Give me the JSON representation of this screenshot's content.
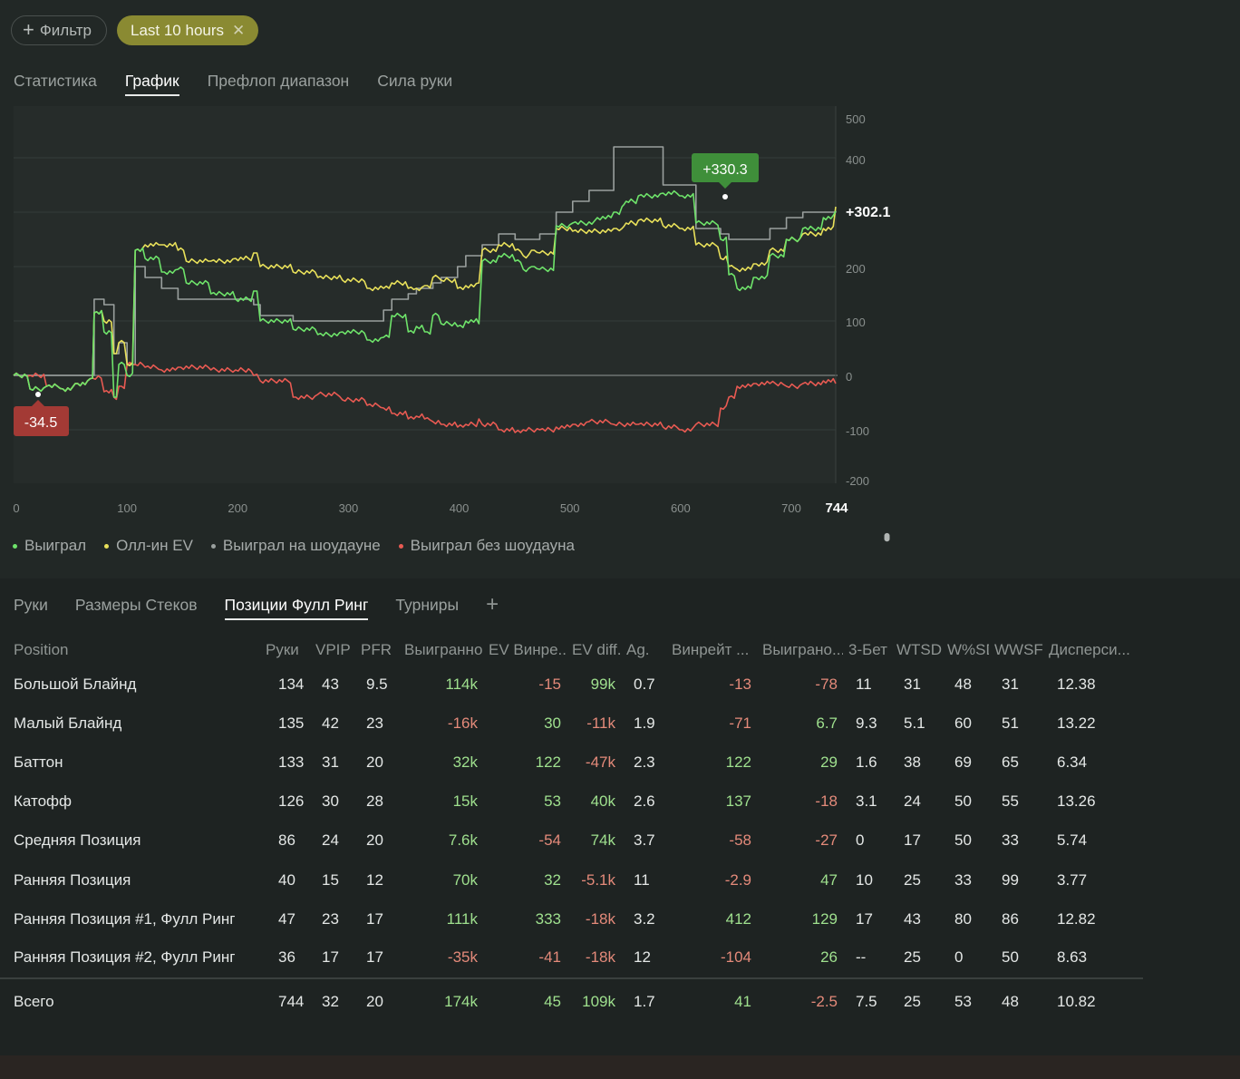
{
  "filters": {
    "add_label": "Фильтр",
    "time_chip": "Last 10 hours"
  },
  "top_tabs": [
    {
      "label": "Статистика",
      "active": false
    },
    {
      "label": "График",
      "active": true
    },
    {
      "label": "Префлоп диапазон",
      "active": false
    },
    {
      "label": "Сила руки",
      "active": false
    }
  ],
  "chart_data": {
    "type": "line",
    "xlim": [
      0,
      744
    ],
    "ylim": [
      -200,
      500
    ],
    "x_ticks": [
      0,
      100,
      200,
      300,
      400,
      500,
      600,
      700
    ],
    "x_end_label": "744",
    "y_ticks": [
      500,
      400,
      200,
      100,
      0,
      -100,
      -200
    ],
    "annotations": [
      {
        "label": "+330.3",
        "x": 642,
        "y": 330.3,
        "color": "#3f8f3a"
      },
      {
        "label": "-34.5",
        "x": 22,
        "y": -34.5,
        "color": "#a33a35"
      },
      {
        "label": "+302.1",
        "x": 744,
        "y": 302.1
      }
    ],
    "series": [
      {
        "name": "Выиграл",
        "color": "#6ee36a",
        "points": [
          [
            0,
            0
          ],
          [
            20,
            -25
          ],
          [
            40,
            -20
          ],
          [
            60,
            -25
          ],
          [
            75,
            -15
          ],
          [
            90,
            -10
          ],
          [
            96,
            -5
          ],
          [
            98,
            115
          ],
          [
            110,
            80
          ],
          [
            122,
            -40
          ],
          [
            128,
            20
          ],
          [
            138,
            0
          ],
          [
            148,
            230
          ],
          [
            160,
            215
          ],
          [
            180,
            190
          ],
          [
            200,
            195
          ],
          [
            210,
            170
          ],
          [
            240,
            150
          ],
          [
            270,
            140
          ],
          [
            292,
            155
          ],
          [
            300,
            100
          ],
          [
            340,
            85
          ],
          [
            370,
            75
          ],
          [
            400,
            80
          ],
          [
            430,
            65
          ],
          [
            450,
            70
          ],
          [
            460,
            110
          ],
          [
            480,
            80
          ],
          [
            490,
            90
          ],
          [
            500,
            80
          ],
          [
            510,
            110
          ],
          [
            520,
            95
          ],
          [
            540,
            90
          ],
          [
            550,
            100
          ],
          [
            566,
            95
          ],
          [
            570,
            210
          ],
          [
            590,
            220
          ],
          [
            610,
            210
          ],
          [
            620,
            195
          ],
          [
            630,
            200
          ],
          [
            640,
            195
          ],
          [
            660,
            275
          ],
          [
            680,
            280
          ],
          [
            710,
            290
          ],
          [
            730,
            300
          ],
          [
            740,
            310
          ],
          [
            745,
            320
          ],
          [
            760,
            330
          ],
          [
            790,
            335
          ],
          [
            810,
            330
          ],
          [
            830,
            280
          ],
          [
            860,
            250
          ],
          [
            870,
            185
          ],
          [
            880,
            160
          ],
          [
            900,
            180
          ],
          [
            920,
            220
          ],
          [
            940,
            250
          ],
          [
            960,
            270
          ],
          [
            985,
            290
          ],
          [
            1000,
            302
          ]
        ]
      },
      {
        "name": "Олл-ин EV",
        "color": "#e8e05a",
        "points": [
          [
            0,
            0
          ],
          [
            20,
            -25
          ],
          [
            40,
            -20
          ],
          [
            60,
            -25
          ],
          [
            75,
            -15
          ],
          [
            90,
            -10
          ],
          [
            96,
            -5
          ],
          [
            98,
            115
          ],
          [
            110,
            100
          ],
          [
            122,
            40
          ],
          [
            128,
            60
          ],
          [
            138,
            20
          ],
          [
            148,
            230
          ],
          [
            160,
            240
          ],
          [
            180,
            240
          ],
          [
            200,
            230
          ],
          [
            210,
            210
          ],
          [
            240,
            210
          ],
          [
            270,
            215
          ],
          [
            292,
            225
          ],
          [
            300,
            200
          ],
          [
            340,
            190
          ],
          [
            370,
            180
          ],
          [
            400,
            175
          ],
          [
            430,
            160
          ],
          [
            450,
            160
          ],
          [
            460,
            170
          ],
          [
            480,
            160
          ],
          [
            490,
            160
          ],
          [
            500,
            165
          ],
          [
            510,
            180
          ],
          [
            520,
            175
          ],
          [
            540,
            160
          ],
          [
            550,
            165
          ],
          [
            566,
            170
          ],
          [
            570,
            230
          ],
          [
            590,
            240
          ],
          [
            610,
            230
          ],
          [
            620,
            220
          ],
          [
            630,
            230
          ],
          [
            640,
            225
          ],
          [
            660,
            270
          ],
          [
            680,
            265
          ],
          [
            710,
            265
          ],
          [
            730,
            270
          ],
          [
            740,
            270
          ],
          [
            745,
            280
          ],
          [
            760,
            285
          ],
          [
            790,
            275
          ],
          [
            810,
            270
          ],
          [
            830,
            240
          ],
          [
            860,
            215
          ],
          [
            870,
            200
          ],
          [
            880,
            195
          ],
          [
            900,
            205
          ],
          [
            920,
            230
          ],
          [
            940,
            250
          ],
          [
            960,
            260
          ],
          [
            985,
            270
          ],
          [
            1000,
            310
          ]
        ]
      },
      {
        "name": "Выиграл на шоудауне",
        "color": "#9aa09e",
        "points": [
          [
            0,
            0
          ],
          [
            60,
            0
          ],
          [
            96,
            0
          ],
          [
            98,
            140
          ],
          [
            110,
            130
          ],
          [
            122,
            40
          ],
          [
            128,
            60
          ],
          [
            138,
            20
          ],
          [
            148,
            200
          ],
          [
            160,
            180
          ],
          [
            180,
            160
          ],
          [
            200,
            140
          ],
          [
            240,
            140
          ],
          [
            270,
            140
          ],
          [
            292,
            130
          ],
          [
            300,
            110
          ],
          [
            340,
            100
          ],
          [
            370,
            100
          ],
          [
            400,
            100
          ],
          [
            430,
            100
          ],
          [
            450,
            120
          ],
          [
            460,
            140
          ],
          [
            480,
            150
          ],
          [
            490,
            160
          ],
          [
            500,
            160
          ],
          [
            510,
            170
          ],
          [
            520,
            180
          ],
          [
            540,
            200
          ],
          [
            550,
            220
          ],
          [
            566,
            220
          ],
          [
            570,
            240
          ],
          [
            590,
            260
          ],
          [
            610,
            250
          ],
          [
            620,
            250
          ],
          [
            640,
            260
          ],
          [
            660,
            300
          ],
          [
            680,
            320
          ],
          [
            700,
            340
          ],
          [
            730,
            420
          ],
          [
            760,
            420
          ],
          [
            790,
            350
          ],
          [
            810,
            350
          ],
          [
            830,
            270
          ],
          [
            860,
            260
          ],
          [
            870,
            250
          ],
          [
            880,
            250
          ],
          [
            900,
            250
          ],
          [
            920,
            270
          ],
          [
            940,
            290
          ],
          [
            960,
            300
          ],
          [
            985,
            300
          ],
          [
            1000,
            302
          ]
        ]
      },
      {
        "name": "Выиграл без шоудауна",
        "color": "#e85a52",
        "points": [
          [
            0,
            0
          ],
          [
            20,
            0
          ],
          [
            40,
            -20
          ],
          [
            60,
            -25
          ],
          [
            75,
            -15
          ],
          [
            90,
            -10
          ],
          [
            96,
            -5
          ],
          [
            110,
            -30
          ],
          [
            122,
            -40
          ],
          [
            128,
            -20
          ],
          [
            138,
            20
          ],
          [
            148,
            20
          ],
          [
            160,
            15
          ],
          [
            180,
            10
          ],
          [
            200,
            15
          ],
          [
            240,
            10
          ],
          [
            270,
            10
          ],
          [
            292,
            0
          ],
          [
            300,
            -10
          ],
          [
            340,
            -40
          ],
          [
            370,
            -35
          ],
          [
            400,
            -45
          ],
          [
            430,
            -55
          ],
          [
            450,
            -60
          ],
          [
            460,
            -70
          ],
          [
            480,
            -80
          ],
          [
            490,
            -75
          ],
          [
            500,
            -80
          ],
          [
            510,
            -85
          ],
          [
            520,
            -90
          ],
          [
            540,
            -95
          ],
          [
            550,
            -90
          ],
          [
            566,
            -80
          ],
          [
            570,
            -90
          ],
          [
            590,
            -100
          ],
          [
            610,
            -105
          ],
          [
            620,
            -100
          ],
          [
            640,
            -100
          ],
          [
            660,
            -95
          ],
          [
            680,
            -90
          ],
          [
            700,
            -85
          ],
          [
            730,
            -90
          ],
          [
            760,
            -90
          ],
          [
            790,
            -95
          ],
          [
            810,
            -100
          ],
          [
            830,
            -90
          ],
          [
            860,
            -60
          ],
          [
            870,
            -40
          ],
          [
            880,
            -20
          ],
          [
            900,
            -15
          ],
          [
            920,
            -15
          ],
          [
            940,
            -20
          ],
          [
            960,
            -15
          ],
          [
            985,
            -10
          ],
          [
            1000,
            -15
          ]
        ]
      }
    ]
  },
  "legend": [
    "Выиграл",
    "Олл-ин EV",
    "Выиграл на шоудауне",
    "Выиграл без шоудауна"
  ],
  "bottom_tabs": [
    {
      "label": "Руки",
      "active": false
    },
    {
      "label": "Размеры Стеков",
      "active": false
    },
    {
      "label": "Позиции Фулл Ринг",
      "active": true
    },
    {
      "label": "Турниры",
      "active": false
    }
  ],
  "add_tab": "+",
  "table": {
    "headers": [
      "Position",
      "Руки",
      "VPIP",
      "PFR",
      "Выигранно",
      "EV Винре...",
      "EV diff.",
      "Ag.",
      "Винрейт ...",
      "Выиграно...",
      "3-Бет",
      "WTSD",
      "W%SD",
      "WWSF%",
      "Дисперси..."
    ],
    "rows": [
      [
        "Большой Блайнд",
        "134",
        "43",
        "9.5",
        "114k",
        "-15",
        "99k",
        "0.7",
        "-13",
        "-78",
        "11",
        "31",
        "48",
        "31",
        "12.38"
      ],
      [
        "Малый Блайнд",
        "135",
        "42",
        "23",
        "-16k",
        "30",
        "-11k",
        "1.9",
        "-71",
        "6.7",
        "9.3",
        "5.1",
        "60",
        "51",
        "13.22"
      ],
      [
        "Баттон",
        "133",
        "31",
        "20",
        "32k",
        "122",
        "-47k",
        "2.3",
        "122",
        "29",
        "1.6",
        "38",
        "69",
        "65",
        "6.34"
      ],
      [
        "Катофф",
        "126",
        "30",
        "28",
        "15k",
        "53",
        "40k",
        "2.6",
        "137",
        "-18",
        "3.1",
        "24",
        "50",
        "55",
        "13.26"
      ],
      [
        "Средняя Позиция",
        "86",
        "24",
        "20",
        "7.6k",
        "-54",
        "74k",
        "3.7",
        "-58",
        "-27",
        "0",
        "17",
        "50",
        "33",
        "5.74"
      ],
      [
        "Ранняя Позиция",
        "40",
        "15",
        "12",
        "70k",
        "32",
        "-5.1k",
        "11",
        "-2.9",
        "47",
        "10",
        "25",
        "33",
        "99",
        "3.77"
      ],
      [
        "Ранняя Позиция #1, Фулл Ринг",
        "47",
        "23",
        "17",
        "111k",
        "333",
        "-18k",
        "3.2",
        "412",
        "129",
        "17",
        "43",
        "80",
        "86",
        "12.82"
      ],
      [
        "Ранняя Позиция #2, Фулл Ринг",
        "36",
        "17",
        "17",
        "-35k",
        "-41",
        "-18k",
        "12",
        "-104",
        "26",
        "--",
        "25",
        "0",
        "50",
        "8.63"
      ]
    ],
    "total": [
      "Всего",
      "744",
      "32",
      "20",
      "174k",
      "45",
      "109k",
      "1.7",
      "41",
      "-2.5",
      "7.5",
      "25",
      "53",
      "48",
      "10.82"
    ]
  }
}
